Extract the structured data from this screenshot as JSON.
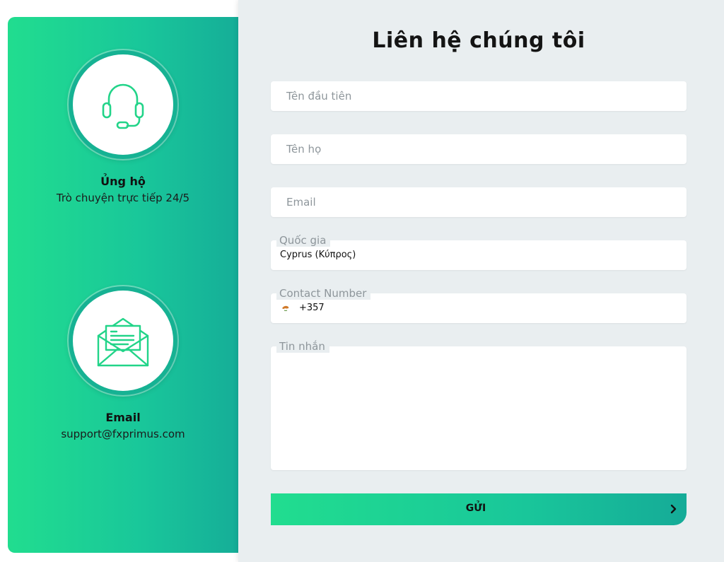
{
  "contact_info": {
    "support": {
      "icon": "headset-icon",
      "title": "Ủng hộ",
      "subtitle": "Trò chuyện trực tiếp 24/5"
    },
    "email": {
      "icon": "envelope-icon",
      "title": "Email",
      "subtitle": "support@fxprimus.com"
    }
  },
  "form": {
    "title": "Liên hệ chúng tôi",
    "first_name": {
      "placeholder": "Tên đầu tiên",
      "value": ""
    },
    "last_name": {
      "placeholder": "Tên họ",
      "value": ""
    },
    "email": {
      "placeholder": "Email",
      "value": ""
    },
    "country": {
      "label": "Quốc gia",
      "value": "Cyprus (Κύπρος)"
    },
    "contact_number": {
      "label": "Contact Number",
      "flag": "cyprus-flag-icon",
      "dial_code": "+357"
    },
    "message": {
      "label": "Tin nhắn",
      "value": ""
    },
    "submit_label": "GỬI",
    "submit_icon": "chevron-right-icon"
  },
  "colors": {
    "accent_start": "#21dd8f",
    "accent_end": "#15ab98",
    "icon_stroke": "#22d489",
    "form_bg": "#e9eef0"
  }
}
